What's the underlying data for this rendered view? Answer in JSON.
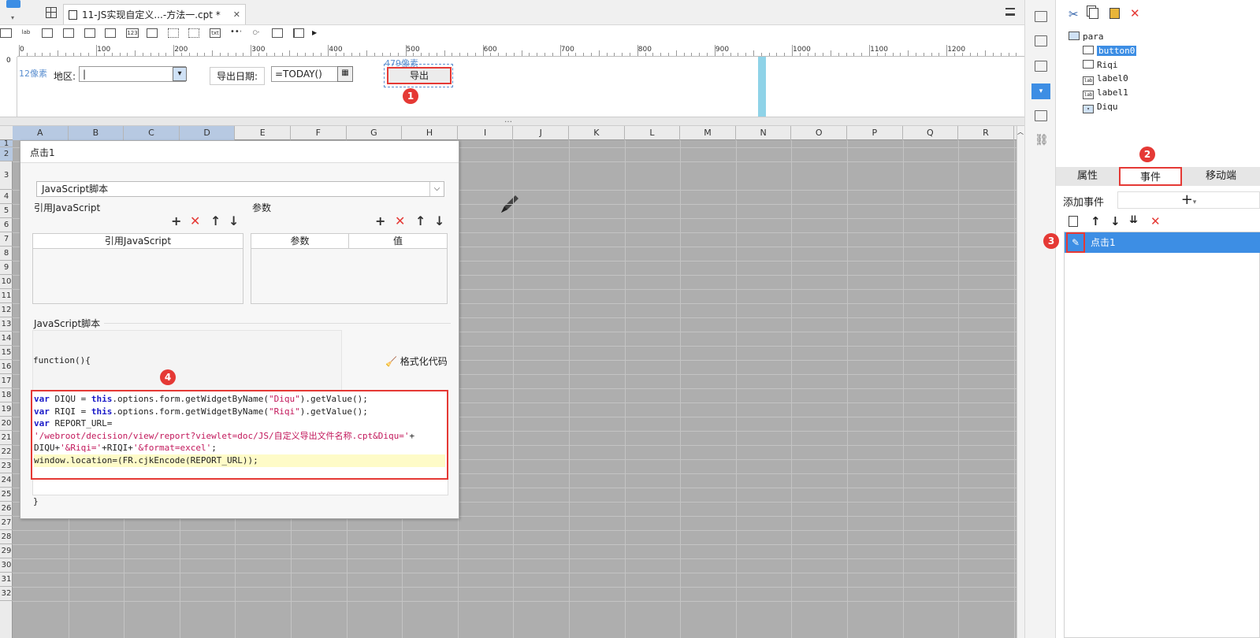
{
  "topbar": {
    "tab_title": "11-JS实现自定义...-方法一.cpt *",
    "tab_close": "✕"
  },
  "toolbar": {
    "label_icon": "lab",
    "num_icon": "123",
    "txt_icon": "txt"
  },
  "ruler": {
    "ticks": [
      "0",
      "100",
      "200",
      "300",
      "400",
      "500",
      "600",
      "700",
      "800",
      "900",
      "1000",
      "1100",
      "1200"
    ],
    "vtick": "0"
  },
  "param": {
    "px_left": "12像素",
    "px_top": "479像素",
    "region_label": "地区:",
    "date_label": "导出日期:",
    "date_value": "=TODAY()",
    "export_button": "导出",
    "badge": "1"
  },
  "grid": {
    "columns": [
      "A",
      "B",
      "C",
      "D",
      "E",
      "F",
      "G",
      "H",
      "I",
      "J",
      "K",
      "L",
      "M",
      "N",
      "O",
      "P",
      "Q",
      "R"
    ],
    "rows": [
      "1",
      "2",
      "3",
      "4",
      "5",
      "6",
      "7",
      "8",
      "9",
      "10",
      "11",
      "12",
      "13",
      "14",
      "15",
      "16",
      "17",
      "18",
      "19",
      "20",
      "21",
      "22",
      "23",
      "24",
      "25",
      "26",
      "27",
      "28",
      "29",
      "30",
      "31",
      "32"
    ]
  },
  "dialog": {
    "title": "点击1",
    "script_type": "JavaScript脚本",
    "ref_js_section": "引用JavaScript",
    "params_section": "参数",
    "ref_js_col": "引用JavaScript",
    "param_col": "参数",
    "value_col": "值",
    "js_section": "JavaScript脚本",
    "function_open": "function(){",
    "format_code": "格式化代码",
    "function_close": "}",
    "badge": "4",
    "code_lines": [
      [
        "var",
        " DIQU = ",
        "this",
        ".options.form.getWidgetByName(",
        "\"Diqu\"",
        ").getValue();"
      ],
      [
        "var",
        " RIQI = ",
        "this",
        ".options.form.getWidgetByName(",
        "\"Riqi\"",
        ").getValue();"
      ],
      [
        "var",
        " REPORT_URL=",
        "",
        "",
        "",
        ""
      ],
      [
        "",
        "",
        "",
        "",
        "'/webroot/decision/view/report?viewlet=doc/JS/自定义导出文件名称.cpt&Diqu='",
        ""
      ],
      [
        "",
        "DIQU+",
        "",
        "",
        "'&Riqi='",
        ""
      ],
      [
        "",
        "window.location=(FR.cjkEncode(REPORT_URL));",
        "",
        "",
        "",
        ""
      ]
    ],
    "code_line3b": "+",
    "code_line4_mid": "+RIQI+",
    "code_line4_str2": "'&format=excel'",
    "code_line4_end": ";"
  },
  "right": {
    "tree": {
      "root": "para",
      "items": [
        "button0",
        "Riqi",
        "label0",
        "label1",
        "Diqu"
      ],
      "selected": "button0"
    },
    "tabs": {
      "properties": "属性",
      "events": "事件",
      "mobile": "移动端"
    },
    "add_event": "添加事件",
    "add_icon": "+",
    "events": [
      "点击1"
    ],
    "badge2": "2",
    "badge3": "3"
  },
  "colors": {
    "accent": "#3d8ee4",
    "alert": "#e53935",
    "grid_bg": "#aeaeae"
  }
}
